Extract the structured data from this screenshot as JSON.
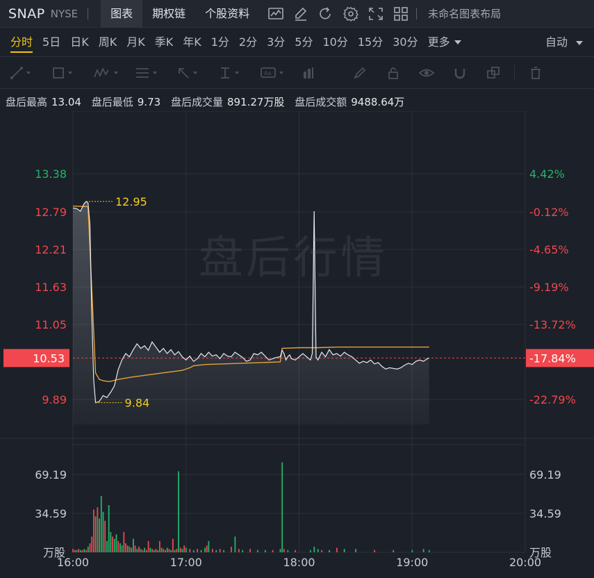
{
  "header": {
    "symbol": "SNAP",
    "exchange": "NYSE",
    "tabs": [
      {
        "label": "图表",
        "active": true
      },
      {
        "label": "期权链",
        "active": false
      },
      {
        "label": "个股资料",
        "active": false
      }
    ],
    "tool_icons": [
      "chart-indicator-icon",
      "draw-pen-icon",
      "refresh-icon",
      "gear-icon",
      "fullscreen-icon",
      "grid-layout-icon"
    ],
    "layout_name": "未命名图表布局"
  },
  "periods": {
    "items": [
      "分时",
      "5日",
      "日K",
      "周K",
      "月K",
      "季K",
      "年K",
      "1分",
      "2分",
      "3分",
      "5分",
      "10分",
      "15分",
      "30分"
    ],
    "active": "分时",
    "more_label": "更多",
    "auto_label": "自动"
  },
  "drawing_tools": [
    "line-tool-icon",
    "rectangle-tool-icon",
    "wave-tool-icon",
    "text-list-tool-icon",
    "arrow-tool-icon",
    "price-range-tool-icon",
    "label-tool-icon",
    "measure-tool-icon",
    "brush-icon",
    "lock-icon",
    "eye-icon",
    "magnet-icon",
    "copy-icon",
    "trash-icon"
  ],
  "info": {
    "high_label": "盘后最高",
    "high_value": "13.04",
    "low_label": "盘后最低",
    "low_value": "9.73",
    "vol_label": "盘后成交量",
    "vol_value": "891.27万股",
    "amt_label": "盘后成交额",
    "amt_value": "9488.64万"
  },
  "watermark": "盘后行情",
  "colors": {
    "up": "#25b36a",
    "down": "#f0484e",
    "price_line": "#e8ebee",
    "avg_line": "#e8a33a",
    "annot": "#f5d020",
    "accent": "#f5c518"
  },
  "chart_data": {
    "type": "line",
    "x_ticks": [
      "16:00",
      "17:00",
      "18:00",
      "19:00",
      "20:00"
    ],
    "x_range_minutes": [
      0,
      240
    ],
    "y_left_ticks": [
      {
        "label": "13.38",
        "value": 13.38,
        "color": "#25b36a"
      },
      {
        "label": "12.79",
        "value": 12.79,
        "color": "#f0484e"
      },
      {
        "label": "12.21",
        "value": 12.21,
        "color": "#f0484e"
      },
      {
        "label": "11.63",
        "value": 11.63,
        "color": "#f0484e"
      },
      {
        "label": "11.05",
        "value": 11.05,
        "color": "#f0484e"
      },
      {
        "label": "9.89",
        "value": 9.89,
        "color": "#f0484e"
      }
    ],
    "y_right_ticks": [
      {
        "label": "4.42%",
        "value": 13.38,
        "color": "#25b36a"
      },
      {
        "label": "-0.12%",
        "value": 12.79,
        "color": "#f0484e"
      },
      {
        "label": "-4.65%",
        "value": 12.21,
        "color": "#f0484e"
      },
      {
        "label": "-9.19%",
        "value": 11.63,
        "color": "#f0484e"
      },
      {
        "label": "-13.72%",
        "value": 11.05,
        "color": "#f0484e"
      },
      {
        "label": "-22.79%",
        "value": 9.89,
        "color": "#f0484e"
      }
    ],
    "current_price": {
      "value": 10.53,
      "label": "10.53",
      "pct_label": "-17.84%"
    },
    "annotations": [
      {
        "value": 12.95,
        "label": "12.95",
        "minute": 7
      },
      {
        "value": 9.84,
        "label": "9.84",
        "minute": 12
      }
    ],
    "price_series": [
      [
        0,
        12.85
      ],
      [
        2,
        12.84
      ],
      [
        4,
        12.8
      ],
      [
        5,
        12.86
      ],
      [
        6,
        12.92
      ],
      [
        7,
        12.95
      ],
      [
        8,
        12.93
      ],
      [
        9,
        12.6
      ],
      [
        10,
        11.2
      ],
      [
        11,
        10.2
      ],
      [
        12,
        9.84
      ],
      [
        14,
        9.86
      ],
      [
        16,
        9.95
      ],
      [
        18,
        9.92
      ],
      [
        20,
        10.0
      ],
      [
        22,
        10.1
      ],
      [
        24,
        10.35
      ],
      [
        26,
        10.5
      ],
      [
        28,
        10.6
      ],
      [
        30,
        10.55
      ],
      [
        32,
        10.66
      ],
      [
        34,
        10.75
      ],
      [
        36,
        10.68
      ],
      [
        38,
        10.72
      ],
      [
        40,
        10.65
      ],
      [
        42,
        10.78
      ],
      [
        44,
        10.7
      ],
      [
        46,
        10.62
      ],
      [
        48,
        10.68
      ],
      [
        50,
        10.6
      ],
      [
        52,
        10.66
      ],
      [
        54,
        10.58
      ],
      [
        56,
        10.63
      ],
      [
        58,
        10.55
      ],
      [
        60,
        10.5
      ],
      [
        62,
        10.56
      ],
      [
        64,
        10.48
      ],
      [
        66,
        10.52
      ],
      [
        68,
        10.6
      ],
      [
        70,
        10.55
      ],
      [
        72,
        10.62
      ],
      [
        74,
        10.56
      ],
      [
        76,
        10.58
      ],
      [
        78,
        10.52
      ],
      [
        80,
        10.6
      ],
      [
        82,
        10.56
      ],
      [
        84,
        10.55
      ],
      [
        86,
        10.62
      ],
      [
        88,
        10.58
      ],
      [
        90,
        10.54
      ],
      [
        92,
        10.48
      ],
      [
        94,
        10.5
      ],
      [
        96,
        10.6
      ],
      [
        98,
        10.58
      ],
      [
        100,
        10.62
      ],
      [
        102,
        10.56
      ],
      [
        104,
        10.5
      ],
      [
        106,
        10.52
      ],
      [
        108,
        10.54
      ],
      [
        110,
        10.55
      ],
      [
        111,
        10.65
      ],
      [
        112,
        10.6
      ],
      [
        113,
        10.5
      ],
      [
        114,
        10.55
      ],
      [
        115,
        10.58
      ],
      [
        116,
        10.52
      ],
      [
        118,
        10.5
      ],
      [
        120,
        10.55
      ],
      [
        122,
        10.6
      ],
      [
        124,
        10.55
      ],
      [
        126,
        10.5
      ],
      [
        127,
        10.6
      ],
      [
        128,
        12.8
      ],
      [
        129,
        10.55
      ],
      [
        130,
        10.5
      ],
      [
        132,
        10.62
      ],
      [
        134,
        10.55
      ],
      [
        136,
        10.66
      ],
      [
        138,
        10.58
      ],
      [
        140,
        10.6
      ],
      [
        142,
        10.56
      ],
      [
        144,
        10.62
      ],
      [
        146,
        10.58
      ],
      [
        148,
        10.55
      ],
      [
        150,
        10.5
      ],
      [
        152,
        10.45
      ],
      [
        154,
        10.48
      ],
      [
        156,
        10.46
      ],
      [
        158,
        10.5
      ],
      [
        160,
        10.44
      ],
      [
        162,
        10.46
      ],
      [
        164,
        10.4
      ],
      [
        166,
        10.36
      ],
      [
        168,
        10.38
      ],
      [
        170,
        10.37
      ],
      [
        172,
        10.36
      ],
      [
        174,
        10.38
      ],
      [
        176,
        10.42
      ],
      [
        178,
        10.45
      ],
      [
        180,
        10.43
      ],
      [
        182,
        10.48
      ],
      [
        184,
        10.5
      ],
      [
        186,
        10.48
      ],
      [
        188,
        10.52
      ],
      [
        189,
        10.53
      ]
    ],
    "avg_series": [
      [
        0,
        12.88
      ],
      [
        8,
        12.87
      ],
      [
        10,
        11.6
      ],
      [
        12,
        10.3
      ],
      [
        14,
        10.2
      ],
      [
        16,
        10.18
      ],
      [
        18,
        10.17
      ],
      [
        20,
        10.17
      ],
      [
        24,
        10.2
      ],
      [
        30,
        10.23
      ],
      [
        40,
        10.27
      ],
      [
        50,
        10.31
      ],
      [
        58,
        10.34
      ],
      [
        60,
        10.36
      ],
      [
        62,
        10.38
      ],
      [
        64,
        10.41
      ],
      [
        70,
        10.43
      ],
      [
        80,
        10.44
      ],
      [
        90,
        10.45
      ],
      [
        100,
        10.46
      ],
      [
        110,
        10.47
      ],
      [
        111,
        10.68
      ],
      [
        120,
        10.69
      ],
      [
        130,
        10.69
      ],
      [
        140,
        10.7
      ],
      [
        150,
        10.7
      ],
      [
        160,
        10.7
      ],
      [
        170,
        10.7
      ],
      [
        180,
        10.7
      ],
      [
        189,
        10.7
      ]
    ],
    "volume_unit": "万股",
    "volume_ticks": [
      {
        "label": "69.19",
        "value": 69.19
      },
      {
        "label": "34.59",
        "value": 34.59
      }
    ],
    "volume_series": [
      [
        0,
        3,
        "d"
      ],
      [
        1,
        2,
        "d"
      ],
      [
        2,
        2,
        "u"
      ],
      [
        3,
        3,
        "d"
      ],
      [
        4,
        2,
        "u"
      ],
      [
        5,
        2,
        "d"
      ],
      [
        6,
        3,
        "u"
      ],
      [
        7,
        2,
        "d"
      ],
      [
        8,
        5,
        "u"
      ],
      [
        9,
        8,
        "d"
      ],
      [
        10,
        14,
        "d"
      ],
      [
        11,
        38,
        "d"
      ],
      [
        12,
        32,
        "u"
      ],
      [
        13,
        40,
        "d"
      ],
      [
        14,
        30,
        "u"
      ],
      [
        15,
        50,
        "u"
      ],
      [
        16,
        36,
        "u"
      ],
      [
        17,
        28,
        "d"
      ],
      [
        18,
        10,
        "u"
      ],
      [
        19,
        42,
        "u"
      ],
      [
        20,
        18,
        "u"
      ],
      [
        21,
        14,
        "d"
      ],
      [
        22,
        12,
        "u"
      ],
      [
        23,
        16,
        "u"
      ],
      [
        24,
        10,
        "d"
      ],
      [
        25,
        8,
        "u"
      ],
      [
        26,
        6,
        "u"
      ],
      [
        27,
        18,
        "d"
      ],
      [
        28,
        8,
        "d"
      ],
      [
        29,
        6,
        "u"
      ],
      [
        30,
        5,
        "d"
      ],
      [
        31,
        4,
        "u"
      ],
      [
        32,
        12,
        "u"
      ],
      [
        33,
        6,
        "d"
      ],
      [
        34,
        3,
        "u"
      ],
      [
        35,
        5,
        "d"
      ],
      [
        36,
        3,
        "u"
      ],
      [
        37,
        2,
        "d"
      ],
      [
        38,
        4,
        "u"
      ],
      [
        39,
        2,
        "d"
      ],
      [
        40,
        10,
        "d"
      ],
      [
        41,
        4,
        "u"
      ],
      [
        42,
        3,
        "d"
      ],
      [
        43,
        2,
        "u"
      ],
      [
        44,
        3,
        "d"
      ],
      [
        45,
        2,
        "u"
      ],
      [
        46,
        10,
        "d"
      ],
      [
        47,
        4,
        "u"
      ],
      [
        48,
        3,
        "d"
      ],
      [
        49,
        2,
        "d"
      ],
      [
        50,
        4,
        "u"
      ],
      [
        51,
        3,
        "d"
      ],
      [
        52,
        2,
        "u"
      ],
      [
        53,
        12,
        "d"
      ],
      [
        54,
        2,
        "u"
      ],
      [
        55,
        3,
        "d"
      ],
      [
        56,
        72,
        "u"
      ],
      [
        57,
        4,
        "d"
      ],
      [
        58,
        3,
        "u"
      ],
      [
        59,
        6,
        "d"
      ],
      [
        60,
        4,
        "u"
      ],
      [
        62,
        3,
        "d"
      ],
      [
        64,
        2,
        "u"
      ],
      [
        66,
        3,
        "d"
      ],
      [
        68,
        2,
        "u"
      ],
      [
        70,
        4,
        "u"
      ],
      [
        71,
        6,
        "d"
      ],
      [
        72,
        10,
        "u"
      ],
      [
        74,
        3,
        "d"
      ],
      [
        76,
        2,
        "u"
      ],
      [
        78,
        3,
        "d"
      ],
      [
        80,
        2,
        "u"
      ],
      [
        84,
        5,
        "d"
      ],
      [
        86,
        14,
        "u"
      ],
      [
        88,
        3,
        "d"
      ],
      [
        90,
        2,
        "u"
      ],
      [
        94,
        3,
        "d"
      ],
      [
        98,
        2,
        "u"
      ],
      [
        102,
        2,
        "u"
      ],
      [
        106,
        2,
        "d"
      ],
      [
        110,
        3,
        "u"
      ],
      [
        111,
        80,
        "u"
      ],
      [
        112,
        3,
        "d"
      ],
      [
        114,
        2,
        "u"
      ],
      [
        118,
        2,
        "d"
      ],
      [
        126,
        2,
        "u"
      ],
      [
        128,
        5,
        "u"
      ],
      [
        130,
        3,
        "u"
      ],
      [
        132,
        2,
        "d"
      ],
      [
        136,
        2,
        "u"
      ],
      [
        140,
        4,
        "d"
      ],
      [
        144,
        3,
        "u"
      ],
      [
        150,
        3,
        "u"
      ],
      [
        160,
        2,
        "d"
      ],
      [
        170,
        2,
        "u"
      ],
      [
        180,
        2,
        "u"
      ],
      [
        186,
        3,
        "u"
      ],
      [
        189,
        2,
        "u"
      ]
    ]
  }
}
